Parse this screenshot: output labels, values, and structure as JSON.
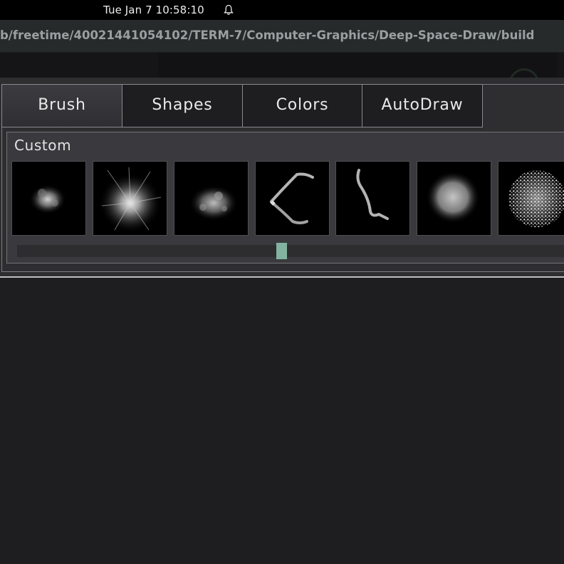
{
  "system_bar": {
    "clock": "Tue Jan 7  10:58:10",
    "notification_icon": "bell-icon"
  },
  "window": {
    "title_path": "b/freetime/40021441054102/TERM-7/Computer-Graphics/Deep-Space-Draw/build"
  },
  "tabs": [
    {
      "label": "Brush",
      "active": true
    },
    {
      "label": "Shapes",
      "active": false
    },
    {
      "label": "Colors",
      "active": false
    },
    {
      "label": "AutoDraw",
      "active": false
    }
  ],
  "brush_panel": {
    "group_label": "Custom",
    "brushes": [
      {
        "name": "cloud-small-brush"
      },
      {
        "name": "burst-brush"
      },
      {
        "name": "cloud-scatter-brush"
      },
      {
        "name": "stroke-angle-brush"
      },
      {
        "name": "stroke-curve-brush"
      },
      {
        "name": "soft-round-brush"
      },
      {
        "name": "noise-round-brush"
      }
    ],
    "scroll_position": 0.47
  },
  "colors": {
    "background": "#1e1e21",
    "panel": "#2e2e31",
    "accent": "#83b2a1",
    "text": "#e9e9e9"
  }
}
